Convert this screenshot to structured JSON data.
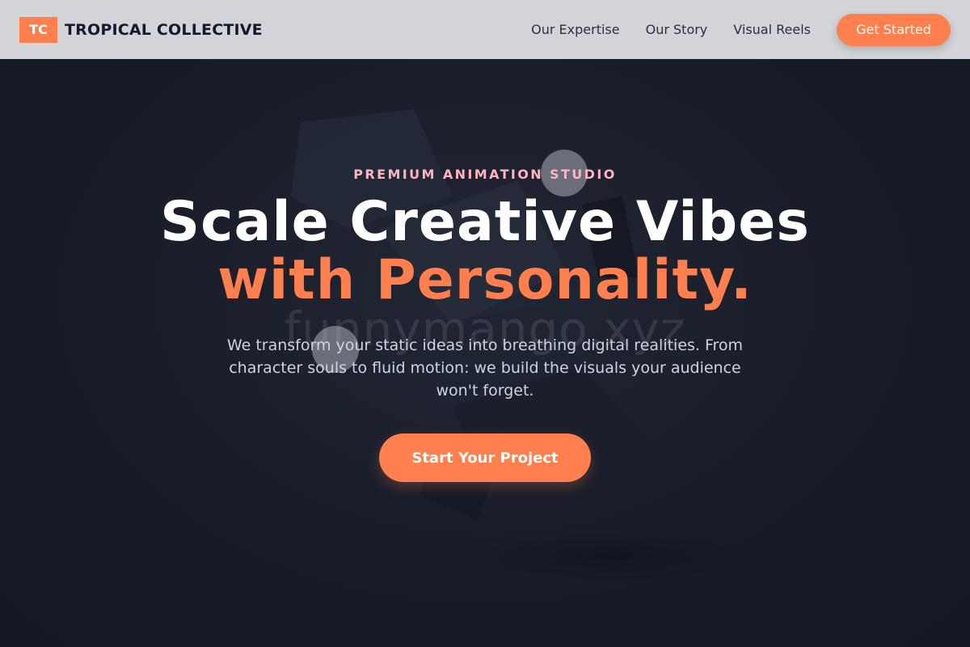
{
  "header": {
    "logo_badge": "TC",
    "brand_name": "TROPICAL COLLECTIVE",
    "nav": [
      {
        "label": "Our Expertise"
      },
      {
        "label": "Our Story"
      },
      {
        "label": "Visual Reels"
      }
    ],
    "cta_label": "Get Started"
  },
  "hero": {
    "eyebrow": "PREMIUM ANIMATION STUDIO",
    "headline_line1": "Scale Creative Vibes",
    "headline_line2": "with Personality.",
    "subtext": "We transform your static ideas into breathing digital realities. From character souls to fluid motion: we build the visuals your audience won't forget.",
    "cta_label": "Start Your Project",
    "watermark": "funnymango.xyz"
  },
  "colors": {
    "accent": "#ff7f4f",
    "eyebrow": "#ffb3c0",
    "navbar_bg": "#d3d4d7",
    "hero_bg": "#181c28"
  }
}
